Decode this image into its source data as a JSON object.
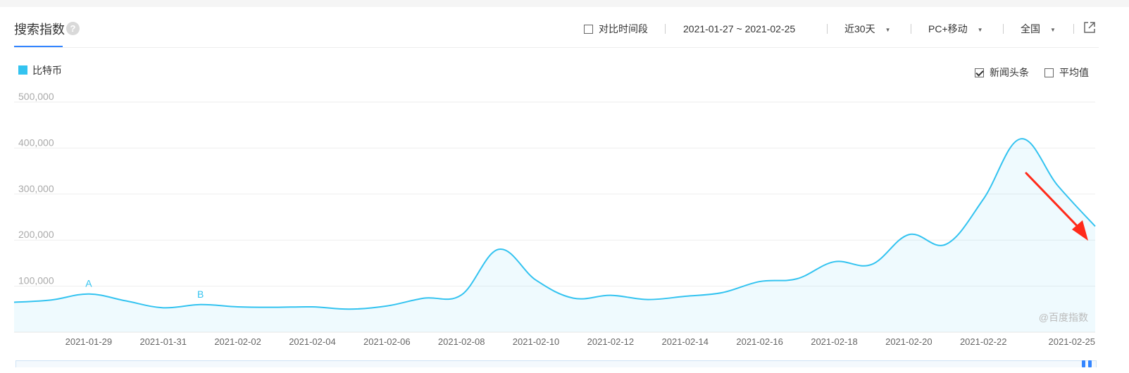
{
  "header": {
    "title": "搜索指数",
    "help_glyph": "?",
    "compare_label": "对比时间段",
    "date_range": "2021-01-27 ~ 2021-02-25",
    "period": "近30天",
    "device": "PC+移动",
    "region": "全国"
  },
  "options": {
    "news_label": "新闻头条",
    "news_checked": true,
    "average_label": "平均值",
    "average_checked": false
  },
  "watermark": "@百度指数",
  "colors": {
    "series": "#33c3f0",
    "accent": "#3385ff",
    "annotation_arrow": "#ff2a1a"
  },
  "icons": [
    "help-icon",
    "share-icon",
    "caret-down-icon",
    "checkbox-icon"
  ],
  "chart_data": {
    "type": "area",
    "x": [
      "2021-01-27",
      "2021-01-28",
      "2021-01-29",
      "2021-01-30",
      "2021-01-31",
      "2021-02-01",
      "2021-02-02",
      "2021-02-03",
      "2021-02-04",
      "2021-02-05",
      "2021-02-06",
      "2021-02-07",
      "2021-02-08",
      "2021-02-09",
      "2021-02-10",
      "2021-02-11",
      "2021-02-12",
      "2021-02-13",
      "2021-02-14",
      "2021-02-15",
      "2021-02-16",
      "2021-02-17",
      "2021-02-18",
      "2021-02-19",
      "2021-02-20",
      "2021-02-21",
      "2021-02-22",
      "2021-02-23",
      "2021-02-24",
      "2021-02-25"
    ],
    "series": [
      {
        "name": "比特币",
        "values": [
          65000,
          70000,
          83000,
          68000,
          53000,
          60000,
          55000,
          54000,
          55000,
          50000,
          57000,
          74000,
          81000,
          180000,
          113000,
          74000,
          80000,
          71000,
          78000,
          86000,
          110000,
          116000,
          153000,
          147000,
          212000,
          191000,
          289000,
          420000,
          318000,
          230000
        ]
      }
    ],
    "ylim": [
      0,
      500000
    ],
    "yticks": [
      "100,000",
      "200,000",
      "300,000",
      "400,000",
      "500,000"
    ],
    "ytick_values": [
      100000,
      200000,
      300000,
      400000,
      500000
    ],
    "xtick_labels": [
      "2021-01-29",
      "2021-01-31",
      "2021-02-02",
      "2021-02-04",
      "2021-02-06",
      "2021-02-08",
      "2021-02-10",
      "2021-02-12",
      "2021-02-14",
      "2021-02-16",
      "2021-02-18",
      "2021-02-20",
      "2021-02-22",
      "2021-02-25"
    ],
    "annotations": [
      {
        "label": "A",
        "x": "2021-01-29",
        "y": 83000
      },
      {
        "label": "B",
        "x": "2021-02-01",
        "y": 60000
      }
    ],
    "grid": true,
    "legend": "top-left"
  }
}
